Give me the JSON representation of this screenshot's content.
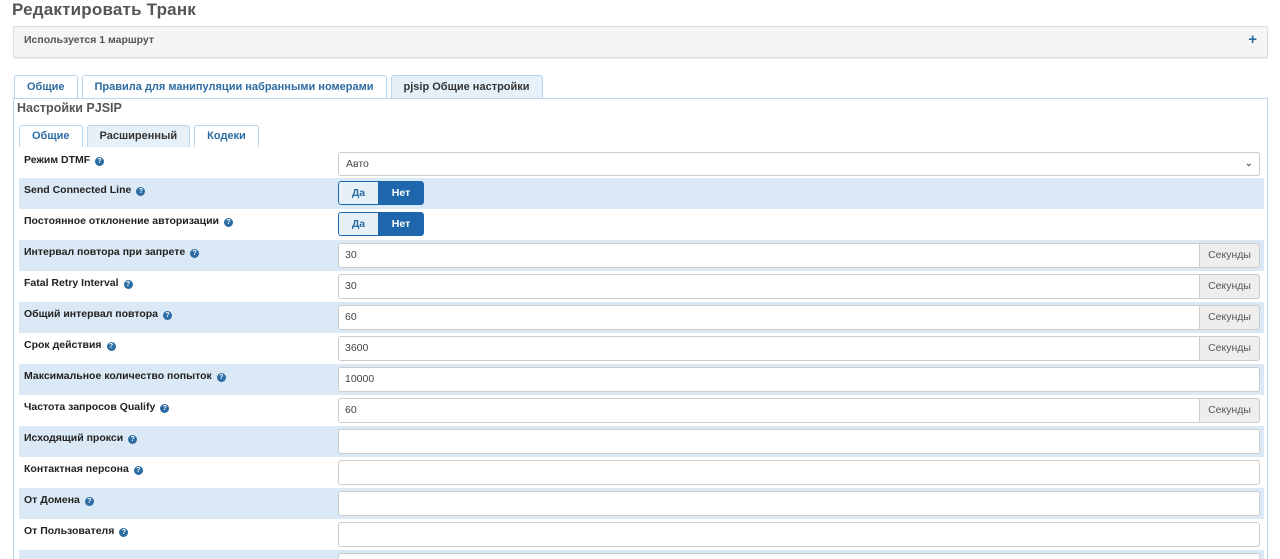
{
  "page": {
    "title": "Редактировать Транк"
  },
  "usage": {
    "text": "Используется 1 маршрут",
    "expand_icon": "plus-icon"
  },
  "top_tabs": [
    {
      "label": "Общие",
      "active": false
    },
    {
      "label": "Правила для манипуляции набранными номерами",
      "active": false
    },
    {
      "label": "pjsip Общие настройки",
      "active": true
    }
  ],
  "section": {
    "title": "Настройки PJSIP"
  },
  "inner_tabs": [
    {
      "label": "Общие",
      "active": false
    },
    {
      "label": "Расширенный",
      "active": true
    },
    {
      "label": "Кодеки",
      "active": false
    }
  ],
  "fields": {
    "dtmf_mode": {
      "label": "Режим DTMF",
      "value": "Авто"
    },
    "send_connected_line": {
      "label": "Send Connected Line",
      "yes": "Да",
      "no": "Нет",
      "selected": "Нет"
    },
    "permanent_auth_reject": {
      "label": "Постоянное отклонение авторизации",
      "yes": "Да",
      "no": "Нет",
      "selected": "Нет"
    },
    "forbidden_retry_interval": {
      "label": "Интервал повтора при запрете",
      "value": "30",
      "unit": "Секунды"
    },
    "fatal_retry_interval": {
      "label": "Fatal Retry Interval",
      "value": "30",
      "unit": "Секунды"
    },
    "general_retry_interval": {
      "label": "Общий интервал повтора",
      "value": "60",
      "unit": "Секунды"
    },
    "expiration": {
      "label": "Срок действия",
      "value": "3600",
      "unit": "Секунды"
    },
    "max_retries": {
      "label": "Максимальное количество попыток",
      "value": "10000"
    },
    "qualify_frequency": {
      "label": "Частота запросов Qualify",
      "value": "60",
      "unit": "Секунды"
    },
    "outbound_proxy": {
      "label": "Исходящий прокси",
      "value": ""
    },
    "contact_user": {
      "label": "Контактная персона",
      "value": ""
    },
    "from_domain": {
      "label": "От Домена",
      "value": ""
    },
    "from_user": {
      "label": "От Пользователя",
      "value": ""
    }
  },
  "icons": {
    "help": "question-circle-icon",
    "dropdown": "chevron-down-icon"
  },
  "colors": {
    "accent": "#1e67ad",
    "link": "#2d6ca2",
    "row_shade": "#dae9f5",
    "tab_border": "#b9d5ee"
  }
}
